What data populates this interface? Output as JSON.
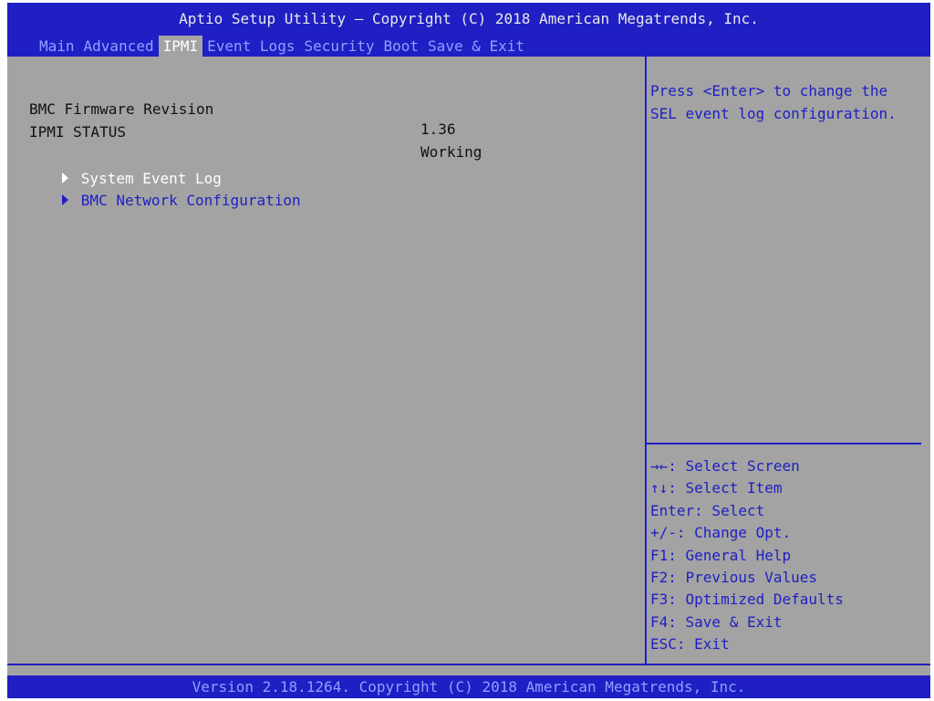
{
  "header": {
    "title": "Aptio Setup Utility – Copyright (C) 2018 American Megatrends, Inc.",
    "tabs": [
      {
        "label": "Main",
        "active": false
      },
      {
        "label": "Advanced",
        "active": false
      },
      {
        "label": "IPMI",
        "active": true
      },
      {
        "label": "Event Logs",
        "active": false
      },
      {
        "label": "Security",
        "active": false
      },
      {
        "label": "Boot",
        "active": false
      },
      {
        "label": "Save & Exit",
        "active": false
      }
    ]
  },
  "main": {
    "info": [
      {
        "label": "BMC Firmware Revision",
        "value": "1.36"
      },
      {
        "label": "IPMI STATUS",
        "value": "Working"
      }
    ],
    "menu": [
      {
        "label": "System Event Log",
        "selected": true
      },
      {
        "label": "BMC Network Configuration",
        "selected": false
      }
    ]
  },
  "help": {
    "text": "Press <Enter> to change the\nSEL event log configuration.",
    "keys": [
      "→←: Select Screen",
      "↑↓: Select Item",
      "Enter: Select",
      "+/-: Change Opt.",
      "F1: General Help",
      "F2: Previous Values",
      "F3: Optimized Defaults",
      "F4: Save & Exit",
      "ESC: Exit"
    ]
  },
  "footer": {
    "text": "Version 2.18.1264. Copyright (C) 2018 American Megatrends, Inc."
  },
  "colors": {
    "header_bg": "#1f1fc4",
    "panel_bg": "#a3a3a3",
    "tab_text": "#8fa0ff",
    "active_text": "#ffffff",
    "static_text": "#111111",
    "link_text": "#1f1fc4"
  }
}
